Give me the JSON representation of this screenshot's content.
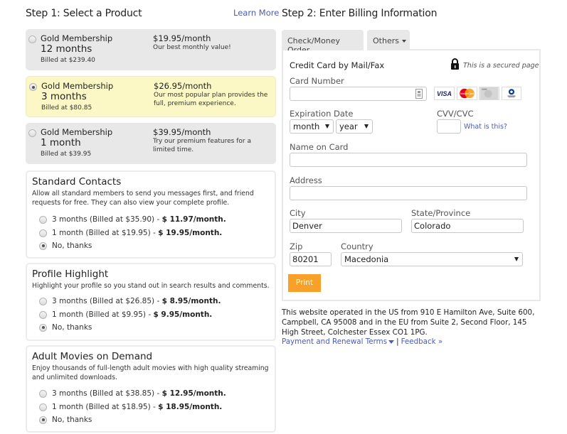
{
  "step1": {
    "title": "Step 1: Select a Product",
    "learn_more": "Learn More",
    "products": [
      {
        "name": "Gold Membership",
        "term": "12 months",
        "billed": "Billed at $239.40",
        "price": "$19.95/month",
        "desc": "Our best monthly value!",
        "selected": false
      },
      {
        "name": "Gold Membership",
        "term": "3 months",
        "billed": "Billed at $80.85",
        "price": "$26.95/month",
        "desc": "Our most popular plan provides the full, premium experience.",
        "selected": true
      },
      {
        "name": "Gold Membership",
        "term": "1 month",
        "billed": "Billed at $39.95",
        "price": "$39.95/month",
        "desc": "Try our premium features for a limited time.",
        "selected": false
      }
    ],
    "addons": [
      {
        "title": "Standard Contacts",
        "desc": "Allow all standard members to send you messages first, and friend requests for free. They can also view your complete profile.",
        "options": [
          {
            "text": "3 months (Billed at $35.90) - ",
            "bold": "$ 11.97/month.",
            "checked": false
          },
          {
            "text": "1 month (Billed at $19.95) - ",
            "bold": "$ 19.95/month.",
            "checked": false
          },
          {
            "text": "No, thanks",
            "bold": "",
            "checked": true
          }
        ]
      },
      {
        "title": "Profile Highlight",
        "desc": "Highlight your profile so you stand out in search results and comments.",
        "options": [
          {
            "text": "3 months (Billed at $26.85) - ",
            "bold": "$ 8.95/month.",
            "checked": false
          },
          {
            "text": "1 month (Billed at $9.95) - ",
            "bold": "$ 9.95/month.",
            "checked": false
          },
          {
            "text": "No, thanks",
            "bold": "",
            "checked": true
          }
        ]
      },
      {
        "title": "Adult Movies on Demand",
        "desc": "Enjoy thousands of full-length adult movies with high quality streaming and unlimited downloads.",
        "options": [
          {
            "text": "3 months (Billed at $38.85) - ",
            "bold": "$ 12.95/month.",
            "checked": false
          },
          {
            "text": "1 month (Billed at $18.95) - ",
            "bold": "$ 18.95/month.",
            "checked": false
          },
          {
            "text": "No, thanks",
            "bold": "",
            "checked": true
          }
        ]
      }
    ]
  },
  "step2": {
    "title": "Step 2: Enter Billing Information",
    "tabs": [
      "Check/Money Order",
      "Others"
    ],
    "panel_title": "Credit Card by Mail/Fax",
    "secure_text": "This is a secured page",
    "card_logos": [
      "visa",
      "mastercard",
      "amex",
      "diners-club"
    ],
    "card_logo_text": {
      "visa": "VISA",
      "mastercard": "MasterCard",
      "diners": "Diners Club"
    },
    "fields": {
      "card_number": {
        "label": "Card Number",
        "value": ""
      },
      "expiration": {
        "label": "Expiration Date",
        "month": "month",
        "year": "year"
      },
      "cvv": {
        "label": "CVV/CVC",
        "value": "",
        "help": "What is this?"
      },
      "name": {
        "label": "Name on Card",
        "value": ""
      },
      "address": {
        "label": "Address",
        "value": ""
      },
      "city": {
        "label": "City",
        "value": "Denver"
      },
      "state": {
        "label": "State/Province",
        "value": "Colorado"
      },
      "zip": {
        "label": "Zip",
        "value": "80201"
      },
      "country": {
        "label": "Country",
        "value": "Macedonia"
      }
    },
    "print_button": "Print",
    "footer_text": "This website operated in the US from 910 E Hamilton Ave, Suite 600, Campbell, CA 95008 and in the EU from Suite 2, Second Floor, 145 High Street, Colchester Essex CO1 1PG.",
    "footer_links": {
      "terms": "Payment and Renewal Terms",
      "separator": "|",
      "feedback": "Feedback »"
    }
  },
  "colors": {
    "accent_orange": "#f7a12b",
    "link_blue": "#4a5cb8",
    "selected_bg": "#fbf8c6",
    "panel_gray": "#e8e8e8"
  }
}
